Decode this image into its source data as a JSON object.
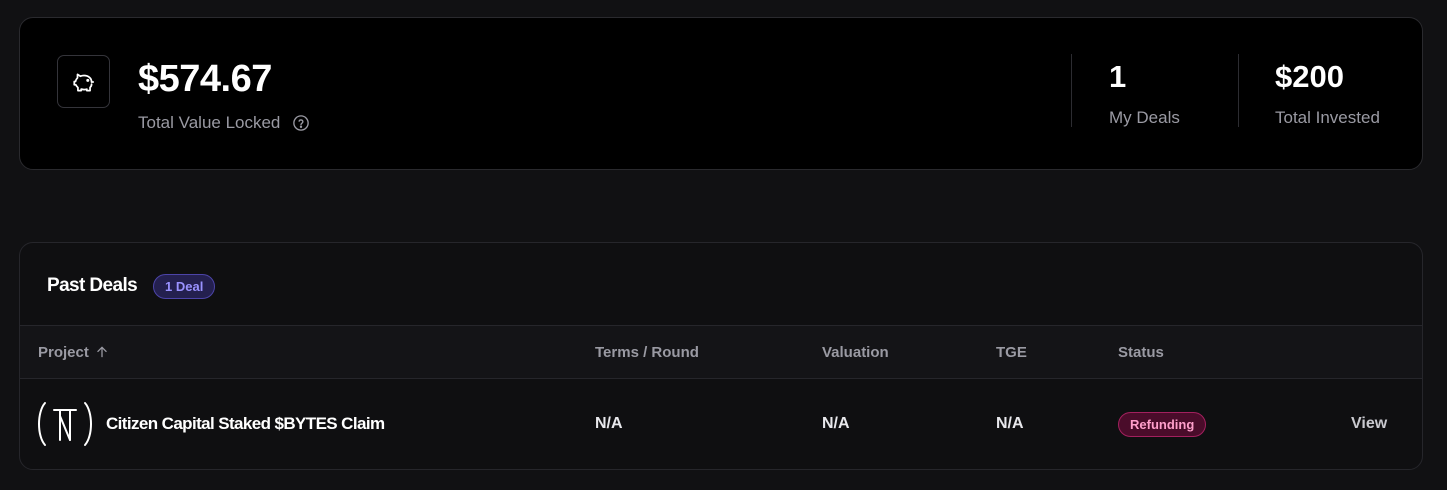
{
  "stats": {
    "tvl_value": "$574.67",
    "tvl_label": "Total Value Locked",
    "tvl_icon": "piggy-bank-icon",
    "help_icon": "question-circle-icon",
    "my_deals_value": "1",
    "my_deals_label": "My Deals",
    "total_invested_value": "$200",
    "total_invested_label": "Total Invested"
  },
  "past_deals": {
    "title": "Past Deals",
    "count_badge": "1 Deal",
    "columns": {
      "project": "Project",
      "terms": "Terms / Round",
      "valuation": "Valuation",
      "tge": "TGE",
      "status": "Status"
    },
    "sort_icon": "arrow-up-icon",
    "rows": [
      {
        "project_name": "Citizen Capital Staked $BYTES Claim",
        "project_logo": "neo-tokyo-logo",
        "terms": "N/A",
        "valuation": "N/A",
        "tge": "N/A",
        "status": "Refunding",
        "action": "View"
      }
    ]
  },
  "colors": {
    "background": "#111113",
    "card": "#000000",
    "deal_badge_text": "#9a92ff",
    "status_refunding_text": "#ff9fcb",
    "status_refunding_bg": "#4a0c2a"
  }
}
